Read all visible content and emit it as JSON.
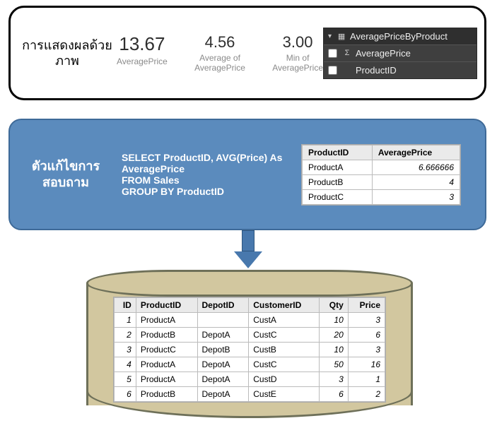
{
  "visual": {
    "title": "การแสดงผลด้วยภาพ",
    "metrics": [
      {
        "value": "13.67",
        "label": "AveragePrice"
      },
      {
        "value": "4.56",
        "label": "Average of AveragePrice"
      },
      {
        "value": "3.00",
        "label": "Min of AveragePrice"
      }
    ],
    "fields": {
      "table": "AveragePriceByProduct",
      "items": [
        {
          "checked": false,
          "icon": "Σ",
          "name": "AveragePrice"
        },
        {
          "checked": false,
          "icon": "",
          "name": "ProductID"
        }
      ]
    }
  },
  "query": {
    "title": "ตัวแก้ไขการสอบถาม",
    "sql": "SELECT ProductID, AVG(Price) As\nAveragePrice\nFROM Sales\nGROUP BY ProductID",
    "result_headers": [
      "ProductID",
      "AveragePrice"
    ],
    "result_rows": [
      {
        "ProductID": "ProductA",
        "AveragePrice": "6.666666"
      },
      {
        "ProductID": "ProductB",
        "AveragePrice": "4"
      },
      {
        "ProductID": "ProductC",
        "AveragePrice": "3"
      }
    ]
  },
  "sales": {
    "headers": [
      "ID",
      "ProductID",
      "DepotID",
      "CustomerID",
      "Qty",
      "Price"
    ],
    "rows": [
      {
        "ID": "1",
        "ProductID": "ProductA",
        "DepotID": "",
        "CustomerID": "CustA",
        "Qty": "10",
        "Price": "3"
      },
      {
        "ID": "2",
        "ProductID": "ProductB",
        "DepotID": "DepotA",
        "CustomerID": "CustC",
        "Qty": "20",
        "Price": "6"
      },
      {
        "ID": "3",
        "ProductID": "ProductC",
        "DepotID": "DepotB",
        "CustomerID": "CustB",
        "Qty": "10",
        "Price": "3"
      },
      {
        "ID": "4",
        "ProductID": "ProductA",
        "DepotID": "DepotA",
        "CustomerID": "CustC",
        "Qty": "50",
        "Price": "16"
      },
      {
        "ID": "5",
        "ProductID": "ProductA",
        "DepotID": "DepotA",
        "CustomerID": "CustD",
        "Qty": "3",
        "Price": "1"
      },
      {
        "ID": "6",
        "ProductID": "ProductB",
        "DepotID": "DepotA",
        "CustomerID": "CustE",
        "Qty": "6",
        "Price": "2"
      }
    ]
  },
  "chart_data": {
    "type": "table",
    "title": "DirectQuery: visual aggregates over query results over source Sales table",
    "visual_cards": [
      {
        "label": "AveragePrice",
        "value": 13.67
      },
      {
        "label": "Average of AveragePrice",
        "value": 4.56
      },
      {
        "label": "Min of AveragePrice",
        "value": 3.0
      }
    ],
    "query_result": {
      "columns": [
        "ProductID",
        "AveragePrice"
      ],
      "rows": [
        [
          "ProductA",
          6.666666
        ],
        [
          "ProductB",
          4
        ],
        [
          "ProductC",
          3
        ]
      ]
    },
    "source_table": {
      "name": "Sales",
      "columns": [
        "ID",
        "ProductID",
        "DepotID",
        "CustomerID",
        "Qty",
        "Price"
      ],
      "rows": [
        [
          1,
          "ProductA",
          null,
          "CustA",
          10,
          3
        ],
        [
          2,
          "ProductB",
          "DepotA",
          "CustC",
          20,
          6
        ],
        [
          3,
          "ProductC",
          "DepotB",
          "CustB",
          10,
          3
        ],
        [
          4,
          "ProductA",
          "DepotA",
          "CustC",
          50,
          16
        ],
        [
          5,
          "ProductA",
          "DepotA",
          "CustD",
          3,
          1
        ],
        [
          6,
          "ProductB",
          "DepotA",
          "CustE",
          6,
          2
        ]
      ]
    }
  }
}
